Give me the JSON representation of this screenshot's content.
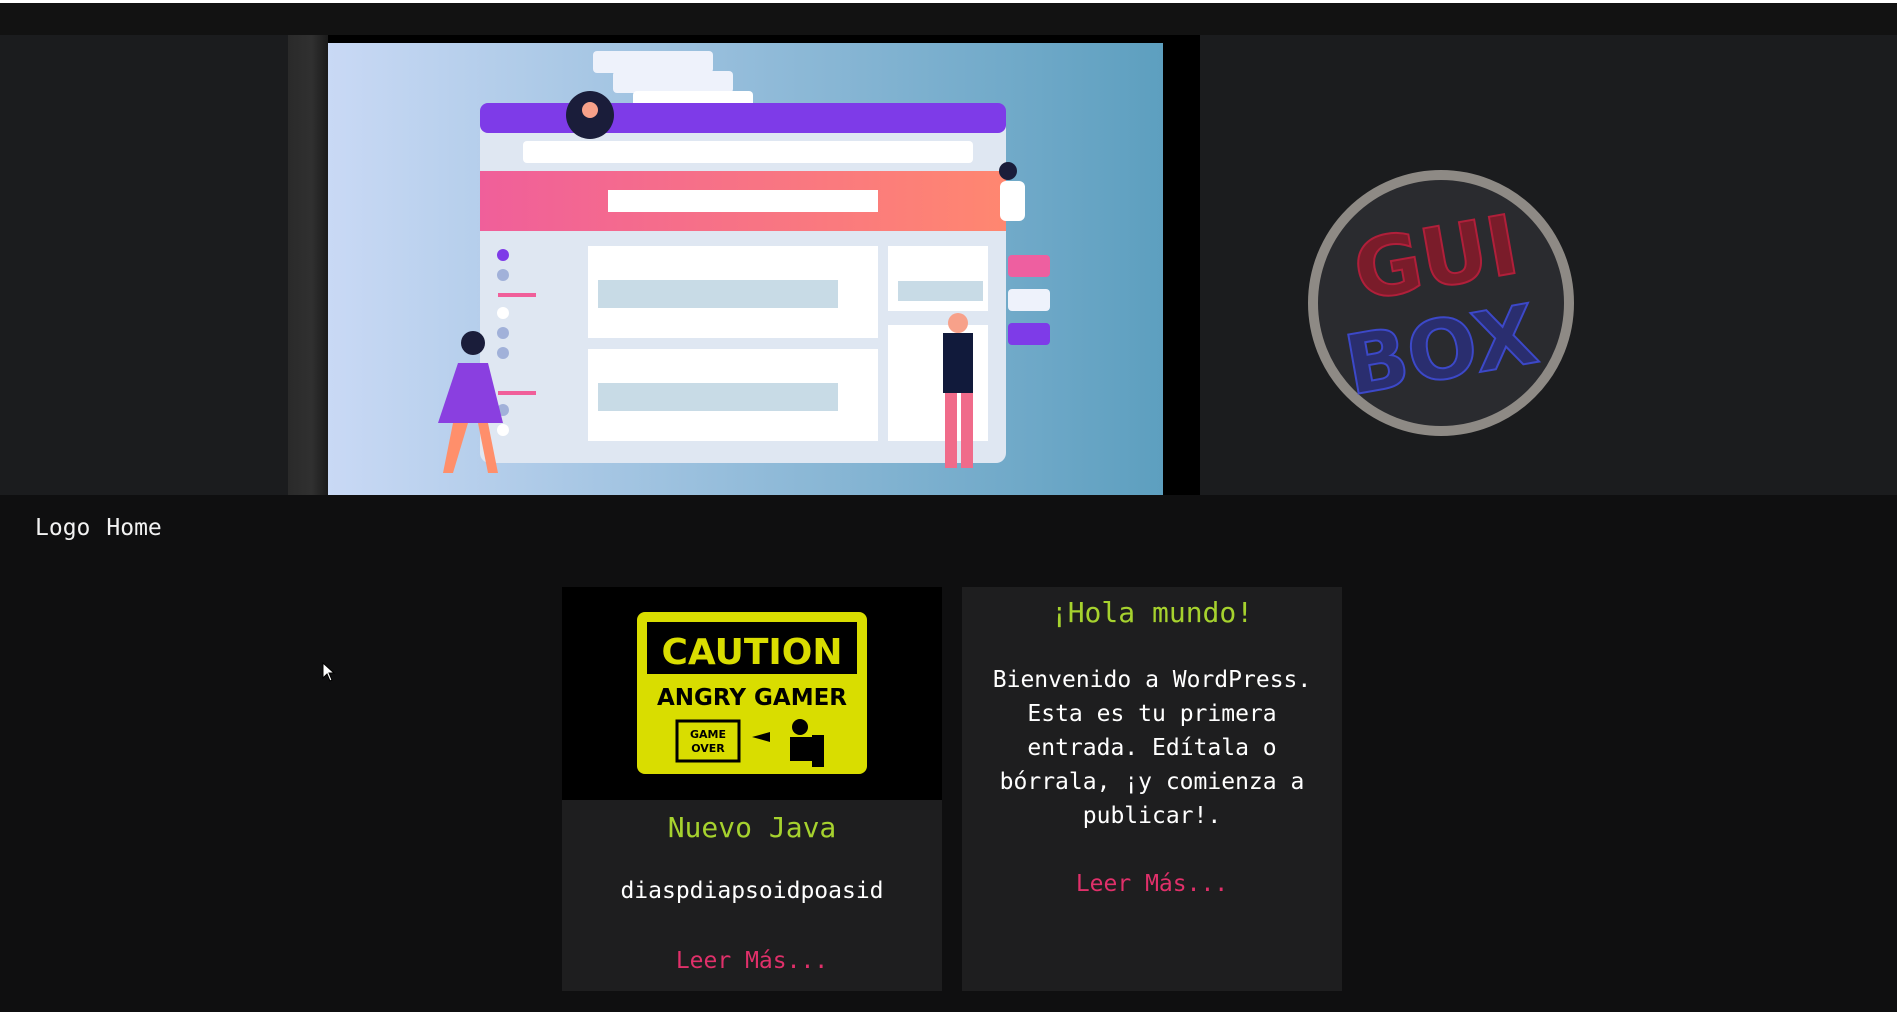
{
  "nav": {
    "logo": "Logo",
    "home": "Home"
  },
  "hero": {
    "illustration": "web-ui-illustration",
    "brand_logo": "guibox-logo",
    "brand_lines": [
      "GUI",
      "BOX"
    ]
  },
  "posts": [
    {
      "title": "Nuevo Java",
      "excerpt": "diaspdiapsoidpoasid",
      "read_more": "Leer Más...",
      "thumb_sign": {
        "line1": "CAUTION",
        "line2": "ANGRY GAMER",
        "monitor_1": "GAME",
        "monitor_2": "OVER"
      }
    },
    {
      "title": "¡Hola mundo!",
      "excerpt": "Bienvenido a WordPress. Esta es tu primera entrada. Edítala o bórrala, ¡y comienza a publicar!.",
      "read_more": "Leer Más..."
    }
  ],
  "colors": {
    "title": "#a6d22e",
    "link": "#e0306a",
    "card_bg": "#1e1e1f",
    "page_bg": "#0f0f10"
  }
}
